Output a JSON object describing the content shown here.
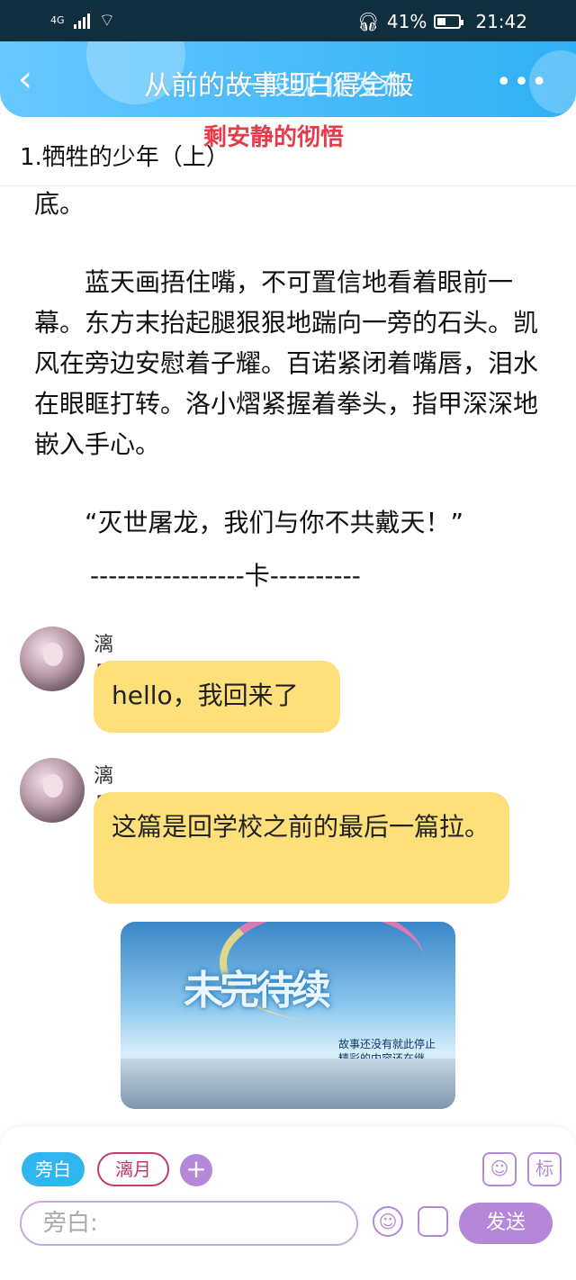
{
  "status_bar": {
    "network": "4G",
    "battery": "41%",
    "time": "21:42"
  },
  "header": {
    "title": "从前的故事坦白得全般",
    "title_overlay": "一般现 促发布",
    "subtitle": "剩安静的彻悟",
    "more": "•••"
  },
  "chapter": "1.牺牲的少年（上）",
  "story": {
    "lines": [
      "底。",
      "蓝天画捂住嘴，不可置信地看着眼前一幕。东方末抬起腿狠狠地踹向一旁的石头。凯风在旁边安慰着子耀。百诺紧闭着嘴唇，泪水在眼眶打转。洛小熠紧握着拳头，指甲深深地嵌入手心。",
      "“灭世屠龙，我们与你不共戴天！”"
    ],
    "divider": "-----------------卡----------"
  },
  "messages": [
    {
      "sender": "漓月",
      "text": "hello，我回来了"
    },
    {
      "sender": "漓月",
      "text": "这篇是回学校之前的最后一篇拉。"
    }
  ],
  "image_message": {
    "banner": "未完待续",
    "caption": "故事还没有就此停止 精彩的内容还在继续……"
  },
  "composer": {
    "role_active": "旁白",
    "role_other": "漓月",
    "add": "+",
    "placeholder": "旁白:",
    "send": "发送",
    "mark": "标"
  },
  "colors": {
    "accent_blue": "#2fb6ee",
    "bubble_yellow": "#fde07a",
    "purple": "#b487d8",
    "title_red": "#e63b4b"
  }
}
